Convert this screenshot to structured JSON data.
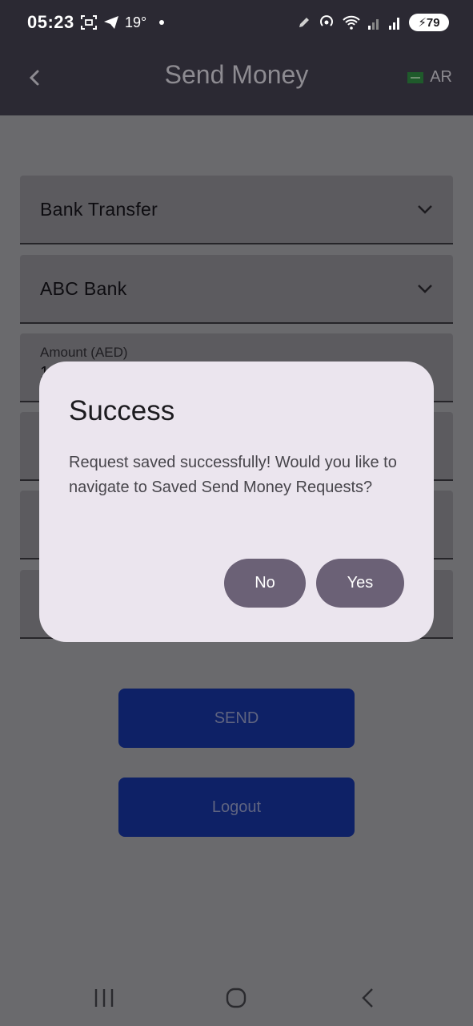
{
  "status_bar": {
    "time": "05:23",
    "temperature": "19°",
    "battery": "79",
    "icons_left": [
      "screenshot-icon",
      "telegram-icon",
      "dot-icon"
    ],
    "icons_right": [
      "pen-icon",
      "hotspot-icon",
      "wifi-icon",
      "signal-icon",
      "signal-icon",
      "battery-icon"
    ]
  },
  "app_bar": {
    "title": "Send Money",
    "language_label": "AR",
    "back_icon": "back-arrow-icon",
    "flag_icon": "saudi-flag-icon"
  },
  "form": {
    "transfer_type": "Bank Transfer",
    "bank": "ABC Bank",
    "amount_label": "Amount (AED)",
    "amount_value_partial": "1"
  },
  "buttons": {
    "send": "SEND",
    "logout": "Logout"
  },
  "dialog": {
    "title": "Success",
    "message": "Request saved successfully! Would you like to navigate to Saved Send Money Requests?",
    "no_label": "No",
    "yes_label": "Yes"
  },
  "nav_bar": {
    "icons": [
      "recents-icon",
      "home-icon",
      "back-icon"
    ]
  },
  "colors": {
    "scrim": "#6a6a6d",
    "app_bar": "#2b2933",
    "button_bg": "#0e2166",
    "dialog_bg": "#ebe5ee",
    "dialog_button": "#6b6176"
  }
}
